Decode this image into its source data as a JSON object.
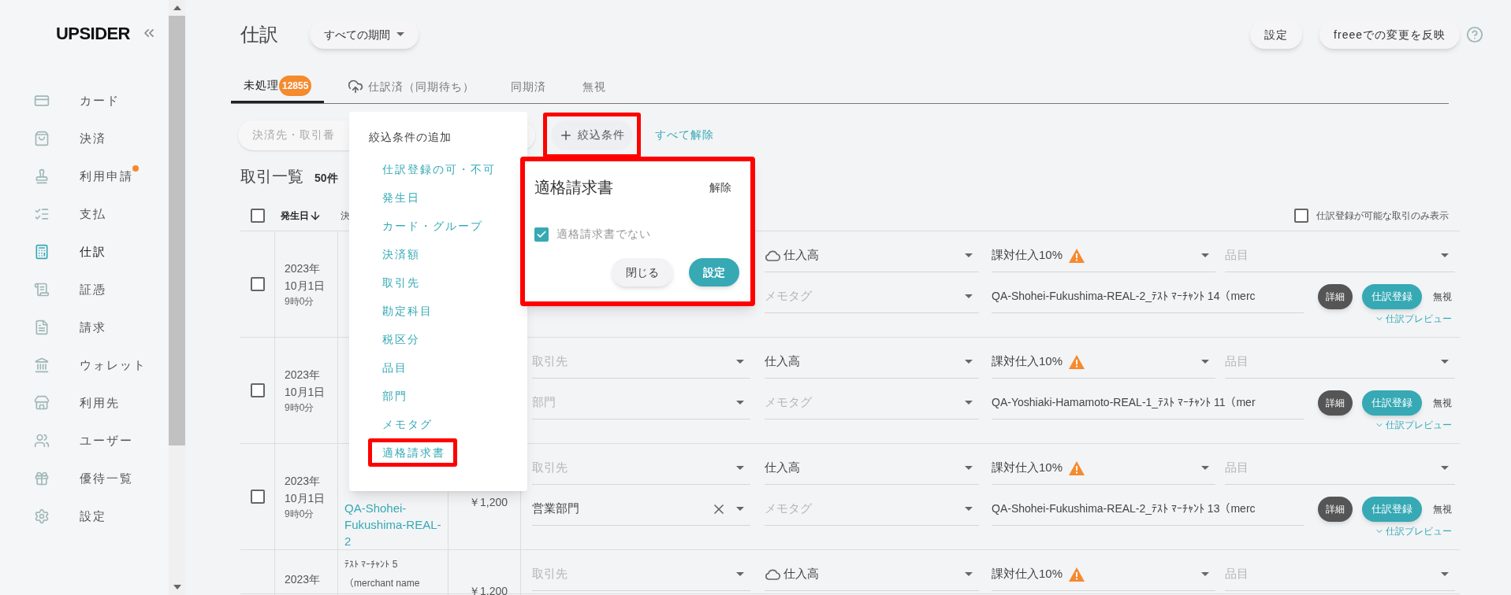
{
  "sidebar": {
    "logo": "UPSIDER",
    "items": [
      {
        "label": "カード",
        "selected": false,
        "notice": false
      },
      {
        "label": "決済",
        "selected": false,
        "notice": false
      },
      {
        "label": "利用申請",
        "selected": false,
        "notice": true
      },
      {
        "label": "支払",
        "selected": false,
        "notice": false
      },
      {
        "label": "仕訳",
        "selected": true,
        "notice": false
      },
      {
        "label": "証憑",
        "selected": false,
        "notice": false
      },
      {
        "label": "請求",
        "selected": false,
        "notice": false
      },
      {
        "label": "ウォレット",
        "selected": false,
        "notice": false
      },
      {
        "label": "利用先",
        "selected": false,
        "notice": false
      },
      {
        "label": "ユーザー",
        "selected": false,
        "notice": false
      },
      {
        "label": "優待一覧",
        "selected": false,
        "notice": false
      },
      {
        "label": "設定",
        "selected": false,
        "notice": false
      }
    ]
  },
  "header": {
    "title": "仕訳",
    "period": "すべての期間",
    "buttons": [
      "設定",
      "freeeでの変更を反映"
    ]
  },
  "tabs": [
    {
      "label": "未処理",
      "badge": "12855",
      "selected": true
    },
    {
      "label": "仕訳済（同期待ち）",
      "selected": false
    },
    {
      "label": "同期済",
      "selected": false
    },
    {
      "label": "無視",
      "selected": false
    }
  ],
  "search": {
    "placeholder": "決済先・取引番"
  },
  "filter_button": {
    "label": "絞込条件",
    "highlighted": true
  },
  "clear_all": "すべて解除",
  "list": {
    "title": "取引一覧",
    "count": "50件"
  },
  "table": {
    "select_all": {
      "checked": false
    },
    "columns": [
      {
        "label": "発生日",
        "sorted": true
      },
      {
        "label": "決",
        "sorted": false
      }
    ],
    "only_registrable": {
      "label": "仕訳登録が可能な取引のみ表示",
      "checked": false
    },
    "rows": [
      {
        "checked": false,
        "date": [
          "2023年",
          "10月1日"
        ],
        "time": "9時0分",
        "account": {
          "value": "仕入高",
          "cloud": true
        },
        "memo_tag": {
          "placeholder": "メモタグ"
        },
        "tax": {
          "value": "課対仕入10%",
          "warning": true
        },
        "item": {
          "placeholder": "品目"
        },
        "description": {
          "value": "QA-Shohei-Fukushima-REAL-2_ﾃｽﾄ ﾏｰﾁｬﾝﾄ 14（merc"
        },
        "actions": [
          "詳細",
          "仕訳登録",
          "無視"
        ],
        "preview": "仕訳プレビュー"
      },
      {
        "checked": false,
        "date": [
          "2023年",
          "10月1日"
        ],
        "time": "9時0分",
        "partner": {
          "placeholder": "取引先"
        },
        "department": {
          "placeholder": "部門"
        },
        "account": {
          "value": "仕入高",
          "cloud": false
        },
        "memo_tag": {
          "placeholder": "メモタグ"
        },
        "tax": {
          "value": "課対仕入10%",
          "warning": true
        },
        "item": {
          "placeholder": "品目"
        },
        "description": {
          "value": "QA-Yoshiaki-Hamamoto-REAL-1_ﾃｽﾄ ﾏｰﾁｬﾝﾄ 11（mer"
        },
        "actions": [
          "詳細",
          "仕訳登録",
          "無視"
        ],
        "preview": "仕訳プレビュー"
      },
      {
        "checked": false,
        "date": [
          "2023年",
          "10月1日"
        ],
        "time": "9時0分",
        "merchant_link": "QA-Shohei-Fukushima-REAL-2",
        "amount": "￥1,200",
        "partner": {
          "placeholder": "取引先"
        },
        "department": {
          "value": "営業部門",
          "clearable": true
        },
        "account": {
          "value": "仕入高",
          "cloud": false
        },
        "memo_tag": {
          "placeholder": "メモタグ"
        },
        "tax": {
          "value": "課対仕入10%",
          "warning": true
        },
        "item": {
          "placeholder": "品目"
        },
        "description": {
          "value": "QA-Shohei-Fukushima-REAL-2_ﾃｽﾄ ﾏｰﾁｬﾝﾄ 13（merc"
        },
        "actions": [
          "詳細",
          "仕訳登録",
          "無視"
        ],
        "preview": "仕訳プレビュー"
      },
      {
        "date": [
          "2023年"
        ],
        "merchant_name": "ﾃｽﾄ ﾏｰﾁｬﾝﾄ 5（merchant name",
        "amount": "￥1,200",
        "partner": {
          "placeholder": "取引先"
        },
        "account": {
          "value": "仕入高",
          "cloud": true
        },
        "tax": {
          "value": "課対仕入10%",
          "warning": true
        },
        "item": {
          "placeholder": "品目"
        }
      }
    ]
  },
  "filter_menu": {
    "title": "絞込条件の追加",
    "items": [
      {
        "label": "仕訳登録の可・不可",
        "highlighted": false
      },
      {
        "label": "発生日",
        "highlighted": false
      },
      {
        "label": "カード・グループ",
        "highlighted": false
      },
      {
        "label": "決済額",
        "highlighted": false
      },
      {
        "label": "取引先",
        "highlighted": false
      },
      {
        "label": "勘定科目",
        "highlighted": false
      },
      {
        "label": "税区分",
        "highlighted": false
      },
      {
        "label": "品目",
        "highlighted": false
      },
      {
        "label": "部門",
        "highlighted": false
      },
      {
        "label": "メモタグ",
        "highlighted": false
      },
      {
        "label": "適格請求書",
        "highlighted": true
      }
    ]
  },
  "filter_popover": {
    "title": "適格請求書",
    "reset": "解除",
    "highlighted": true,
    "option": {
      "label": "適格請求書でない",
      "checked": true
    },
    "buttons": [
      "閉じる",
      "設定"
    ]
  }
}
